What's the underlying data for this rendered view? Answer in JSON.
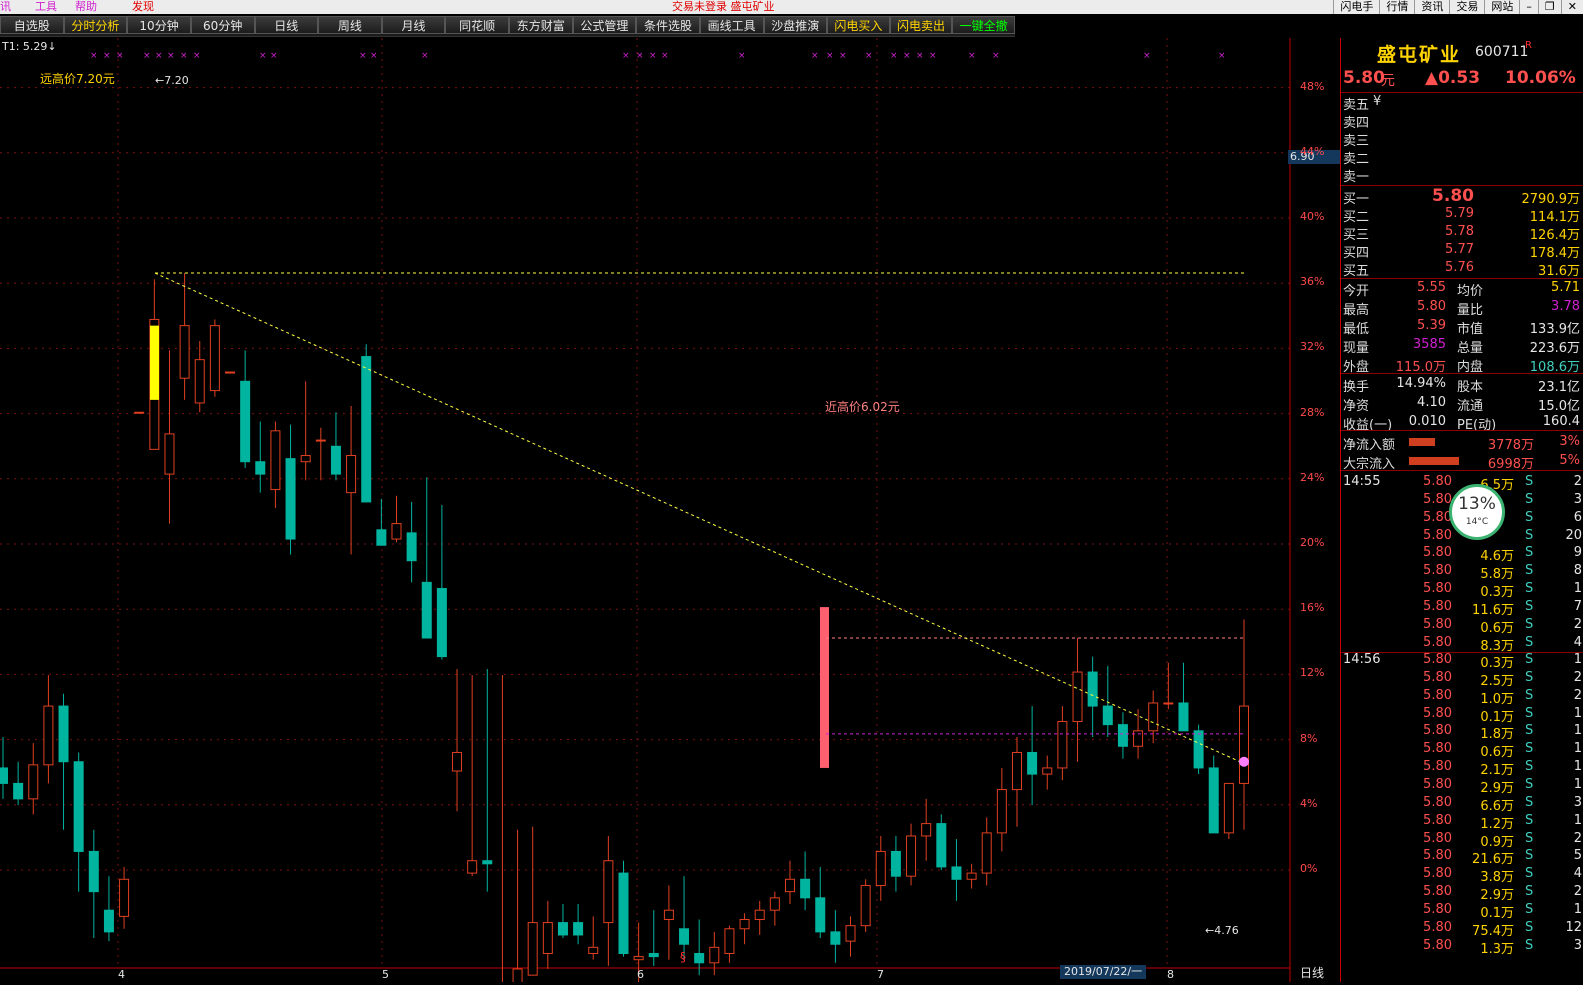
{
  "menubar": {
    "left": [
      "讯",
      "工具",
      "帮助",
      "发现"
    ],
    "center": "交易未登录  盛屯矿业",
    "right": [
      "闪电手",
      "行情",
      "资讯",
      "交易",
      "网站"
    ]
  },
  "toolbar": [
    "自选股",
    "分时分析",
    "10分钟",
    "60分钟",
    "日线",
    "周线",
    "月线",
    "同花顺",
    "东方财富",
    "公式管理",
    "条件选股",
    "画线工具",
    "沙盘推演",
    "闪电买入",
    "闪电卖出",
    "一键全撤"
  ],
  "chart": {
    "indicator": "T1: 5.29↓",
    "high_label": "远高价7.20元",
    "high_value": "7.20",
    "near_high_label": "近高价6.02元",
    "low_value": "4.76",
    "price_tag": "6.90",
    "y_ticks": [
      "48%",
      "44%",
      "40%",
      "36%",
      "32%",
      "28%",
      "24%",
      "20%",
      "16%",
      "12%",
      "8%",
      "4%",
      "0%"
    ],
    "x_ticks": [
      "4",
      "5",
      "6",
      "7",
      "8"
    ],
    "date_box": "2019/07/22/一",
    "period": "日线",
    "marker": "§"
  },
  "chart_data": {
    "type": "candlestick",
    "baseline": 5.27,
    "candles": [
      {
        "o": 5.6,
        "h": 5.7,
        "l": 5.5,
        "c": 5.55
      },
      {
        "o": 5.55,
        "h": 5.62,
        "l": 5.48,
        "c": 5.5
      },
      {
        "o": 5.5,
        "h": 5.68,
        "l": 5.45,
        "c": 5.61
      },
      {
        "o": 5.61,
        "h": 5.9,
        "l": 5.55,
        "c": 5.8
      },
      {
        "o": 5.8,
        "h": 5.84,
        "l": 5.4,
        "c": 5.62
      },
      {
        "o": 5.62,
        "h": 5.65,
        "l": 5.2,
        "c": 5.33
      },
      {
        "o": 5.33,
        "h": 5.4,
        "l": 5.05,
        "c": 5.2
      },
      {
        "o": 5.14,
        "h": 5.25,
        "l": 5.04,
        "c": 5.07
      },
      {
        "o": 5.12,
        "h": 5.28,
        "l": 5.08,
        "c": 5.24
      },
      {
        "o": 6.75,
        "h": 6.75,
        "l": 6.75,
        "c": 6.75
      },
      {
        "o": 6.63,
        "h": 7.18,
        "l": 6.63,
        "c": 7.05
      },
      {
        "o": 6.55,
        "h": 6.95,
        "l": 6.39,
        "c": 6.68
      },
      {
        "o": 6.86,
        "h": 7.2,
        "l": 6.79,
        "c": 7.03
      },
      {
        "o": 6.78,
        "h": 6.98,
        "l": 6.75,
        "c": 6.92
      },
      {
        "o": 6.82,
        "h": 7.05,
        "l": 6.8,
        "c": 7.03
      },
      {
        "o": 6.88,
        "h": 6.88,
        "l": 6.88,
        "c": 6.88
      },
      {
        "o": 6.85,
        "h": 6.95,
        "l": 6.57,
        "c": 6.59
      },
      {
        "o": 6.59,
        "h": 6.72,
        "l": 6.49,
        "c": 6.55
      },
      {
        "o": 6.5,
        "h": 6.72,
        "l": 6.44,
        "c": 6.69
      },
      {
        "o": 6.6,
        "h": 6.71,
        "l": 6.29,
        "c": 6.34
      },
      {
        "o": 6.59,
        "h": 6.85,
        "l": 6.53,
        "c": 6.61
      },
      {
        "o": 6.66,
        "h": 6.7,
        "l": 6.53,
        "c": 6.66
      },
      {
        "o": 6.64,
        "h": 6.75,
        "l": 6.53,
        "c": 6.55
      },
      {
        "o": 6.49,
        "h": 6.77,
        "l": 6.29,
        "c": 6.61
      },
      {
        "o": 6.93,
        "h": 6.97,
        "l": 6.49,
        "c": 6.46
      },
      {
        "o": 6.37,
        "h": 6.47,
        "l": 6.33,
        "c": 6.32
      },
      {
        "o": 6.34,
        "h": 6.48,
        "l": 6.33,
        "c": 6.39
      },
      {
        "o": 6.36,
        "h": 6.46,
        "l": 6.2,
        "c": 6.27
      },
      {
        "o": 6.2,
        "h": 6.54,
        "l": 6.18,
        "c": 6.02
      },
      {
        "o": 6.18,
        "h": 6.45,
        "l": 5.95,
        "c": 5.96
      },
      {
        "o": 5.59,
        "h": 5.92,
        "l": 5.46,
        "c": 5.65
      },
      {
        "o": 5.26,
        "h": 5.9,
        "l": 5.25,
        "c": 5.3
      },
      {
        "o": 5.3,
        "h": 5.92,
        "l": 5.2,
        "c": 5.29
      },
      {
        "o": 4.77,
        "h": 5.9,
        "l": 4.77,
        "c": 4.86
      },
      {
        "o": 4.86,
        "h": 5.4,
        "l": 4.77,
        "c": 4.95
      },
      {
        "o": 4.93,
        "h": 5.41,
        "l": 4.97,
        "c": 5.1
      },
      {
        "o": 5.0,
        "h": 5.17,
        "l": 4.95,
        "c": 5.1
      },
      {
        "o": 5.1,
        "h": 5.16,
        "l": 5.05,
        "c": 5.06
      },
      {
        "o": 5.1,
        "h": 5.16,
        "l": 5.03,
        "c": 5.06
      },
      {
        "o": 5.0,
        "h": 5.12,
        "l": 4.98,
        "c": 5.02
      },
      {
        "o": 5.1,
        "h": 5.38,
        "l": 4.96,
        "c": 5.3
      },
      {
        "o": 5.26,
        "h": 5.3,
        "l": 4.99,
        "c": 5.0
      },
      {
        "o": 4.98,
        "h": 5.1,
        "l": 4.88,
        "c": 4.99
      },
      {
        "o": 5.0,
        "h": 5.14,
        "l": 4.96,
        "c": 4.99
      },
      {
        "o": 5.11,
        "h": 5.22,
        "l": 4.98,
        "c": 5.14
      },
      {
        "o": 5.08,
        "h": 5.25,
        "l": 4.98,
        "c": 5.03
      },
      {
        "o": 5.0,
        "h": 5.11,
        "l": 4.93,
        "c": 4.97
      },
      {
        "o": 4.97,
        "h": 5.07,
        "l": 4.93,
        "c": 5.02
      },
      {
        "o": 5.0,
        "h": 5.09,
        "l": 4.97,
        "c": 5.08
      },
      {
        "o": 5.08,
        "h": 5.13,
        "l": 5.03,
        "c": 5.11
      },
      {
        "o": 5.11,
        "h": 5.17,
        "l": 5.06,
        "c": 5.14
      },
      {
        "o": 5.14,
        "h": 5.2,
        "l": 5.09,
        "c": 5.18
      },
      {
        "o": 5.2,
        "h": 5.3,
        "l": 5.16,
        "c": 5.24
      },
      {
        "o": 5.24,
        "h": 5.33,
        "l": 5.14,
        "c": 5.18
      },
      {
        "o": 5.18,
        "h": 5.28,
        "l": 5.05,
        "c": 5.07
      },
      {
        "o": 5.07,
        "h": 5.14,
        "l": 4.97,
        "c": 5.03
      },
      {
        "o": 5.04,
        "h": 5.12,
        "l": 4.99,
        "c": 5.09
      },
      {
        "o": 5.09,
        "h": 5.24,
        "l": 5.07,
        "c": 5.22
      },
      {
        "o": 5.22,
        "h": 5.38,
        "l": 5.17,
        "c": 5.33
      },
      {
        "o": 5.33,
        "h": 5.38,
        "l": 5.2,
        "c": 5.25
      },
      {
        "o": 5.25,
        "h": 5.42,
        "l": 5.22,
        "c": 5.38
      },
      {
        "o": 5.38,
        "h": 5.5,
        "l": 5.3,
        "c": 5.42
      },
      {
        "o": 5.42,
        "h": 5.45,
        "l": 5.27,
        "c": 5.28
      },
      {
        "o": 5.28,
        "h": 5.37,
        "l": 5.17,
        "c": 5.24
      },
      {
        "o": 5.24,
        "h": 5.29,
        "l": 5.21,
        "c": 5.26
      },
      {
        "o": 5.26,
        "h": 5.44,
        "l": 5.22,
        "c": 5.39
      },
      {
        "o": 5.39,
        "h": 5.6,
        "l": 5.33,
        "c": 5.53
      },
      {
        "o": 5.53,
        "h": 5.7,
        "l": 5.41,
        "c": 5.65
      },
      {
        "o": 5.65,
        "h": 5.8,
        "l": 5.48,
        "c": 5.58
      },
      {
        "o": 5.58,
        "h": 5.64,
        "l": 5.53,
        "c": 5.6
      },
      {
        "o": 5.6,
        "h": 5.8,
        "l": 5.56,
        "c": 5.75
      },
      {
        "o": 5.75,
        "h": 6.02,
        "l": 5.62,
        "c": 5.91
      },
      {
        "o": 5.91,
        "h": 5.96,
        "l": 5.7,
        "c": 5.8
      },
      {
        "o": 5.8,
        "h": 5.93,
        "l": 5.7,
        "c": 5.74
      },
      {
        "o": 5.74,
        "h": 5.78,
        "l": 5.63,
        "c": 5.67
      },
      {
        "o": 5.67,
        "h": 5.79,
        "l": 5.63,
        "c": 5.72
      },
      {
        "o": 5.72,
        "h": 5.85,
        "l": 5.68,
        "c": 5.81
      },
      {
        "o": 5.81,
        "h": 5.94,
        "l": 5.79,
        "c": 5.81
      },
      {
        "o": 5.81,
        "h": 5.94,
        "l": 5.72,
        "c": 5.72
      },
      {
        "o": 5.72,
        "h": 5.74,
        "l": 5.58,
        "c": 5.6
      },
      {
        "o": 5.6,
        "h": 5.64,
        "l": 5.39,
        "c": 5.39
      },
      {
        "o": 5.39,
        "h": 5.55,
        "l": 5.37,
        "c": 5.55
      },
      {
        "o": 5.55,
        "h": 6.08,
        "l": 5.4,
        "c": 5.8
      }
    ],
    "trendline": {
      "from_price": 7.2,
      "to_price": 5.62
    },
    "levels": [
      7.2,
      6.02,
      5.71
    ]
  },
  "quote": {
    "name": "盛屯矿业",
    "code": "600711",
    "flag": "R",
    "price": "5.80",
    "unit": "元",
    "change": "▲0.53",
    "pct": "10.06%",
    "ask_labels": [
      "卖五",
      "卖四",
      "卖三",
      "卖二",
      "卖一"
    ],
    "ask_currency": "¥",
    "bids": [
      {
        "label": "买一",
        "price": "5.80",
        "vol": "2790.9万"
      },
      {
        "label": "买二",
        "price": "5.79",
        "vol": "114.1万"
      },
      {
        "label": "买三",
        "price": "5.78",
        "vol": "126.4万"
      },
      {
        "label": "买四",
        "price": "5.77",
        "vol": "178.4万"
      },
      {
        "label": "买五",
        "price": "5.76",
        "vol": "31.6万"
      }
    ],
    "stats": [
      {
        "l1": "今开",
        "v1": "5.55",
        "l2": "均价",
        "v2": "5.71"
      },
      {
        "l1": "最高",
        "v1": "5.80",
        "l2": "量比",
        "v2": "3.78"
      },
      {
        "l1": "最低",
        "v1": "5.39",
        "l2": "市值",
        "v2": "133.9亿"
      },
      {
        "l1": "现量",
        "v1": "3585",
        "l2": "总量",
        "v2": "223.6万"
      },
      {
        "l1": "外盘",
        "v1": "115.0万",
        "l2": "内盘",
        "v2": "108.6万"
      }
    ],
    "stats2": [
      {
        "l1": "换手",
        "v1": "14.94%",
        "l2": "股本",
        "v2": "23.1亿"
      },
      {
        "l1": "净资",
        "v1": "4.10",
        "l2": "流通",
        "v2": "15.0亿"
      },
      {
        "l1": "收益(一)",
        "v1": "0.010",
        "l2": "PE(动)",
        "v2": "160.4"
      }
    ],
    "flow": [
      {
        "label": "净流入额",
        "value": "3778万",
        "pct": "3%"
      },
      {
        "label": "大宗流入",
        "value": "6998万",
        "pct": "5%"
      }
    ],
    "ticks_1455": {
      "time": "14:55",
      "rows": [
        {
          "p": "5.80",
          "v": "6.5万",
          "n": "2"
        },
        {
          "p": "5.80",
          "v": "",
          "n": "3"
        },
        {
          "p": "5.80",
          "v": "",
          "n": "6"
        },
        {
          "p": "5.80",
          "v": "",
          "n": "20"
        },
        {
          "p": "5.80",
          "v": "4.6万",
          "n": "9"
        },
        {
          "p": "5.80",
          "v": "5.8万",
          "n": "8"
        },
        {
          "p": "5.80",
          "v": "0.3万",
          "n": "1"
        },
        {
          "p": "5.80",
          "v": "11.6万",
          "n": "7"
        },
        {
          "p": "5.80",
          "v": "0.6万",
          "n": "2"
        },
        {
          "p": "5.80",
          "v": "8.3万",
          "n": "4"
        }
      ]
    },
    "ticks_1456": {
      "time": "14:56",
      "rows": [
        {
          "p": "5.80",
          "v": "0.3万",
          "n": "1"
        },
        {
          "p": "5.80",
          "v": "2.5万",
          "n": "2"
        },
        {
          "p": "5.80",
          "v": "1.0万",
          "n": "2"
        },
        {
          "p": "5.80",
          "v": "0.1万",
          "n": "1"
        },
        {
          "p": "5.80",
          "v": "1.8万",
          "n": "1"
        },
        {
          "p": "5.80",
          "v": "0.6万",
          "n": "1"
        },
        {
          "p": "5.80",
          "v": "2.1万",
          "n": "1"
        },
        {
          "p": "5.80",
          "v": "2.9万",
          "n": "1"
        },
        {
          "p": "5.80",
          "v": "6.6万",
          "n": "3"
        },
        {
          "p": "5.80",
          "v": "1.2万",
          "n": "1"
        },
        {
          "p": "5.80",
          "v": "0.9万",
          "n": "2"
        },
        {
          "p": "5.80",
          "v": "21.6万",
          "n": "5"
        },
        {
          "p": "5.80",
          "v": "3.8万",
          "n": "4"
        },
        {
          "p": "5.80",
          "v": "2.9万",
          "n": "2"
        },
        {
          "p": "5.80",
          "v": "0.1万",
          "n": "1"
        },
        {
          "p": "5.80",
          "v": "75.4万",
          "n": "12"
        },
        {
          "p": "5.80",
          "v": "1.3万",
          "n": "3"
        }
      ]
    },
    "tick_side": "S",
    "widget": {
      "pct": "13%",
      "temp": "14°C"
    }
  }
}
